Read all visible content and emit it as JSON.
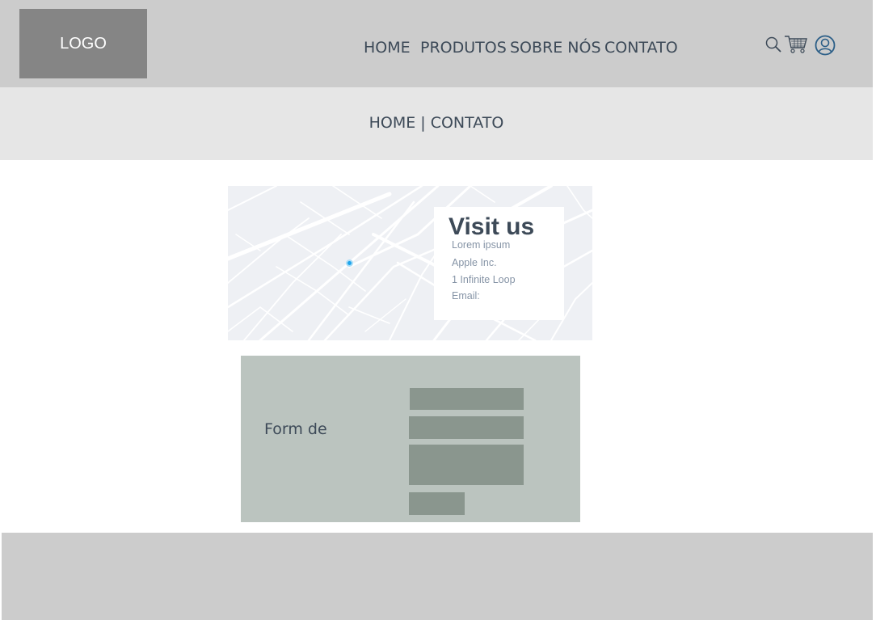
{
  "header": {
    "logo": "LOGO",
    "nav": [
      "HOME",
      "PRODUTOS",
      "SOBRE NÓS",
      "CONTATO"
    ],
    "icons": [
      "search-icon",
      "cart-icon",
      "user-icon"
    ]
  },
  "breadcrumb": {
    "home": "HOME",
    "separator": "|",
    "current": "CONTATO"
  },
  "map_card": {
    "title": "Visit us",
    "lines": [
      "Lorem ipsum",
      "Apple Inc.",
      "1 Infinite Loop",
      "Email:"
    ]
  },
  "form": {
    "label": "Form de"
  },
  "colors": {
    "header_bg": "#cccccc",
    "logo_bg": "#858585",
    "band_bg": "#e6e6e6",
    "text": "#3d4a58",
    "map_pin": "#1ea5ec",
    "form_bg": "#bbc4bf",
    "field_bg": "#8a968e"
  }
}
